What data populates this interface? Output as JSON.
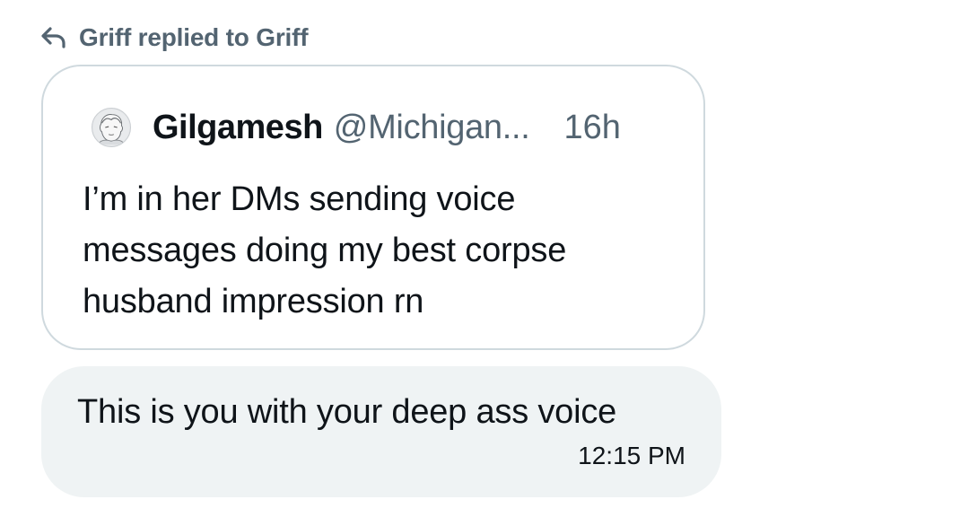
{
  "reply_header": {
    "icon": "reply-arrow-icon",
    "text": "Griff replied to Griff"
  },
  "quoted_post": {
    "avatar": "avatar",
    "author_name": "Gilgamesh",
    "author_handle": "@Michigan...",
    "time_ago": "16h",
    "text": "I’m in her DMs sending voice\nmessages doing my best corpse\nhusband impression rn"
  },
  "message": {
    "text": "This is you with your deep ass voice",
    "timestamp": "12:15 PM"
  },
  "colors": {
    "bubble_background": "#eff3f4",
    "card_border": "#cfd9de",
    "secondary_text": "#536471",
    "primary_text": "#0f1419"
  }
}
